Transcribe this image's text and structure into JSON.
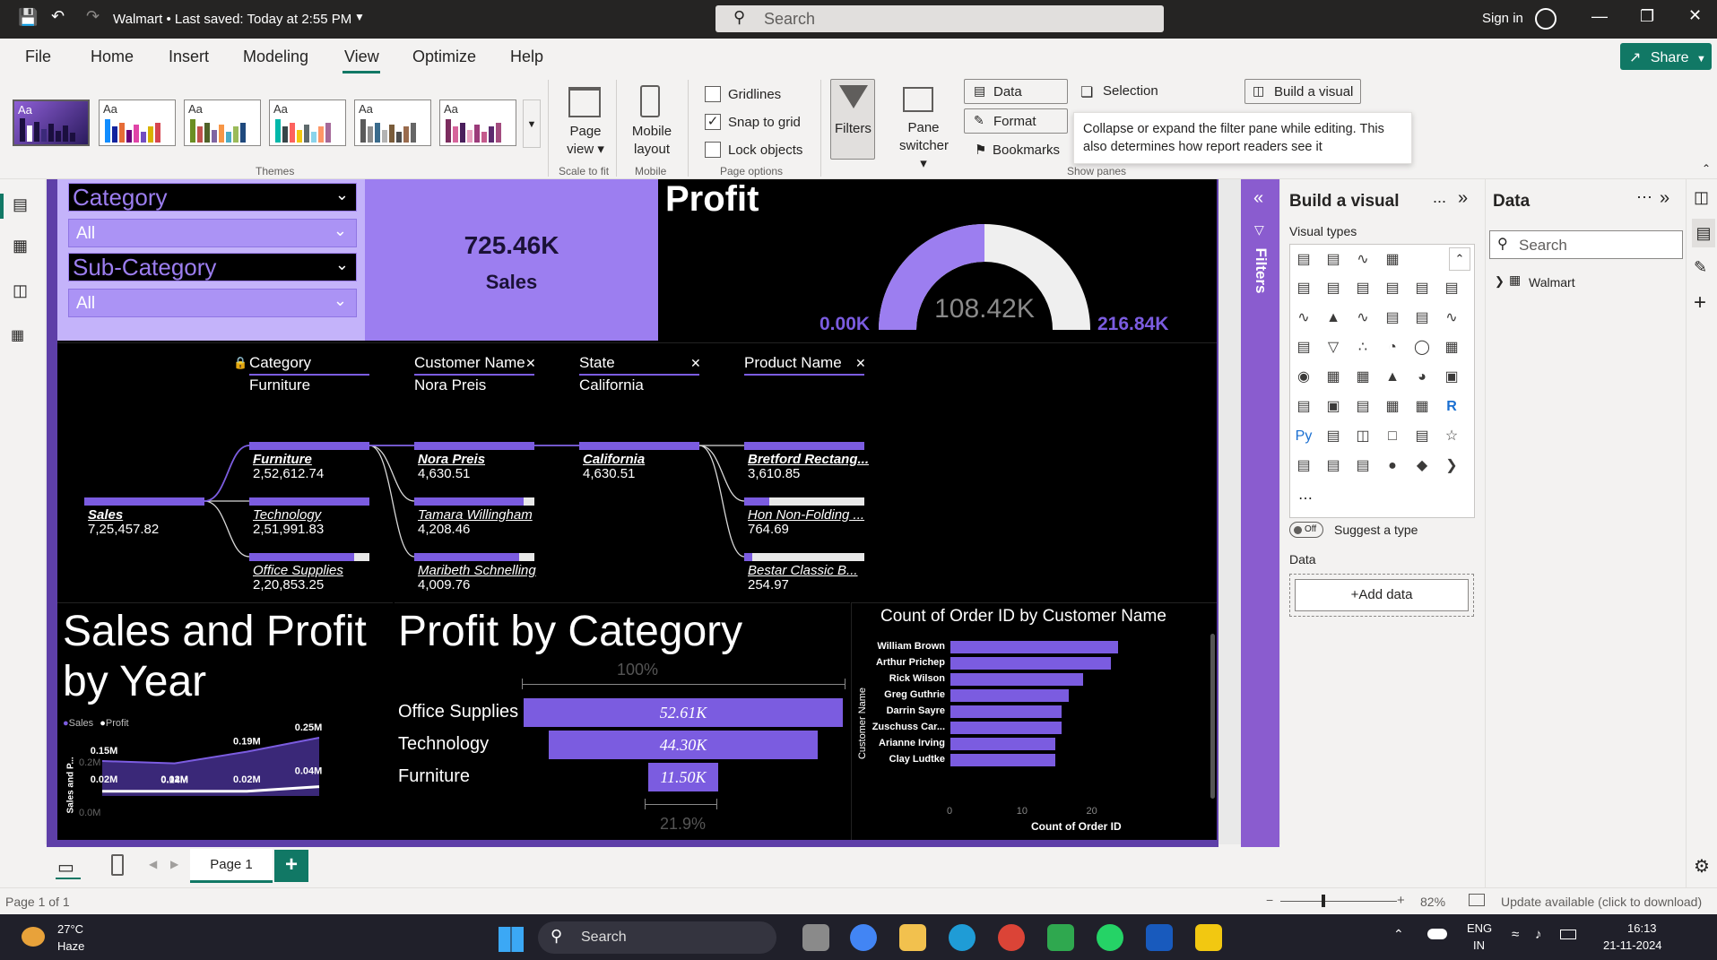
{
  "titlebar": {
    "title": "Walmart • Last saved: Today at 2:55 PM",
    "search_placeholder": "Search",
    "sign_in": "Sign in"
  },
  "menu": {
    "items": [
      "File",
      "Home",
      "Insert",
      "Modeling",
      "View",
      "Optimize",
      "Help"
    ],
    "active": "View",
    "share": "Share"
  },
  "ribbon": {
    "themes_label": "Themes",
    "theme_aa": "Aa",
    "page_view": "Page view",
    "scale_to_fit": "Scale to fit",
    "mobile_layout": "Mobile layout",
    "mobile": "Mobile",
    "gridlines": "Gridlines",
    "snap_to_grid": "Snap to grid",
    "lock_objects": "Lock objects",
    "page_options": "Page options",
    "filters": "Filters",
    "pane_switcher": "Pane switcher",
    "data": "Data",
    "format": "Format",
    "bookmarks": "Bookmarks",
    "selection": "Selection",
    "build_visual": "Build a visual",
    "show_panes": "Show panes",
    "tooltip": "Collapse or expand the filter pane while editing. This also determines how report readers see it"
  },
  "report": {
    "slicer1": {
      "title": "Category",
      "value": "All"
    },
    "slicer2": {
      "title": "Sub-Category",
      "value": "All"
    },
    "card": {
      "value": "725.46K",
      "label": "Sales"
    },
    "gauge": {
      "title": "Profit",
      "value": "108.42K",
      "min": "0.00K",
      "max": "216.84K",
      "fraction": 0.5
    },
    "decomp": {
      "levels": [
        {
          "title": "Category",
          "value": "Furniture"
        },
        {
          "title": "Customer Name",
          "value": "Nora Preis"
        },
        {
          "title": "State",
          "value": "California"
        },
        {
          "title": "Product Name",
          "value": ""
        }
      ],
      "root": {
        "name": "Sales",
        "value": "7,25,457.82"
      },
      "col1": [
        {
          "name": "Furniture",
          "value": "2,52,612.74",
          "frac": 1.0
        },
        {
          "name": "Technology",
          "value": "2,51,991.83",
          "frac": 1.0
        },
        {
          "name": "Office Supplies",
          "value": "2,20,853.25",
          "frac": 0.87
        }
      ],
      "col2": [
        {
          "name": "Nora Preis",
          "value": "4,630.51",
          "frac": 1.0
        },
        {
          "name": "Tamara Willingham",
          "value": "4,208.46",
          "frac": 0.91
        },
        {
          "name": "Maribeth Schnelling",
          "value": "4,009.76",
          "frac": 0.87
        }
      ],
      "col3": [
        {
          "name": "California",
          "value": "4,630.51",
          "frac": 1.0
        }
      ],
      "col4": [
        {
          "name": "Bretford Rectang...",
          "value": "3,610.85",
          "frac": 1.0
        },
        {
          "name": "Hon Non-Folding ...",
          "value": "764.69",
          "frac": 0.21
        },
        {
          "name": "Bestar Classic B...",
          "value": "254.97",
          "frac": 0.07
        }
      ]
    },
    "linechart": {
      "title": "Sales and Profit by Year",
      "legend": [
        "Sales",
        "Profit"
      ],
      "ylabel": "Sales and P...",
      "yticks": [
        "0.2M",
        "0.0M"
      ]
    },
    "funnel": {
      "title": "Profit by Category",
      "top_pct": "100%",
      "bottom_pct": "21.9%"
    },
    "barchart": {
      "title": "Count of Order ID by Customer Name",
      "ylabel": "Customer Name",
      "xlabel": "Count of Order ID",
      "xticks": [
        "0",
        "10",
        "20"
      ]
    }
  },
  "chart_data": [
    {
      "type": "line",
      "title": "Sales and Profit by Year",
      "series": [
        {
          "name": "Sales",
          "values": [
            0.15,
            0.14,
            0.19,
            0.25
          ],
          "labels": [
            "0.15M",
            "0.14M",
            "0.19M",
            "0.25M"
          ]
        },
        {
          "name": "Profit",
          "values": [
            0.02,
            0.02,
            0.02,
            0.04
          ],
          "labels": [
            "0.02M",
            "0.02M",
            "0.02M",
            "0.04M"
          ]
        }
      ],
      "ylim": [
        0,
        0.25
      ],
      "colors": [
        "#7b5ce0",
        "#ffffff"
      ]
    },
    {
      "type": "bar",
      "title": "Profit by Category",
      "categories": [
        "Office Supplies",
        "Technology",
        "Furniture"
      ],
      "values": [
        52.61,
        44.3,
        11.5
      ],
      "labels": [
        "52.61K",
        "44.30K",
        "11.50K"
      ]
    },
    {
      "type": "bar",
      "title": "Count of Order ID by Customer Name",
      "categories": [
        "William Brown",
        "Arthur Prichep",
        "Rick Wilson",
        "Greg Guthrie",
        "Darrin Sayre",
        "Zuschuss Car...",
        "Arianne Irving",
        "Clay Ludtke"
      ],
      "values": [
        24,
        23,
        19,
        17,
        16,
        16,
        15,
        15
      ],
      "xlim": [
        0,
        27
      ],
      "xlabel": "Count of Order ID",
      "ylabel": "Customer Name"
    }
  ],
  "build_pane": {
    "title": "Build a visual",
    "visual_types": "Visual types",
    "suggest_toggle": "Off",
    "suggest_label": "Suggest a type",
    "data_label": "Data",
    "add_data": "+Add data",
    "more": "..."
  },
  "filters_label": "Filters",
  "data_pane": {
    "title": "Data",
    "search_placeholder": "Search",
    "table": "Walmart"
  },
  "tabs": {
    "page1": "Page 1",
    "add": "+"
  },
  "status": {
    "page": "Page 1 of 1",
    "zoom": "82%",
    "update": "Update available (click to download)"
  },
  "taskbar": {
    "temp": "27°C",
    "weather": "Haze",
    "search": "Search",
    "lang1": "ENG",
    "lang2": "IN",
    "time": "16:13",
    "date": "21-11-2024"
  }
}
